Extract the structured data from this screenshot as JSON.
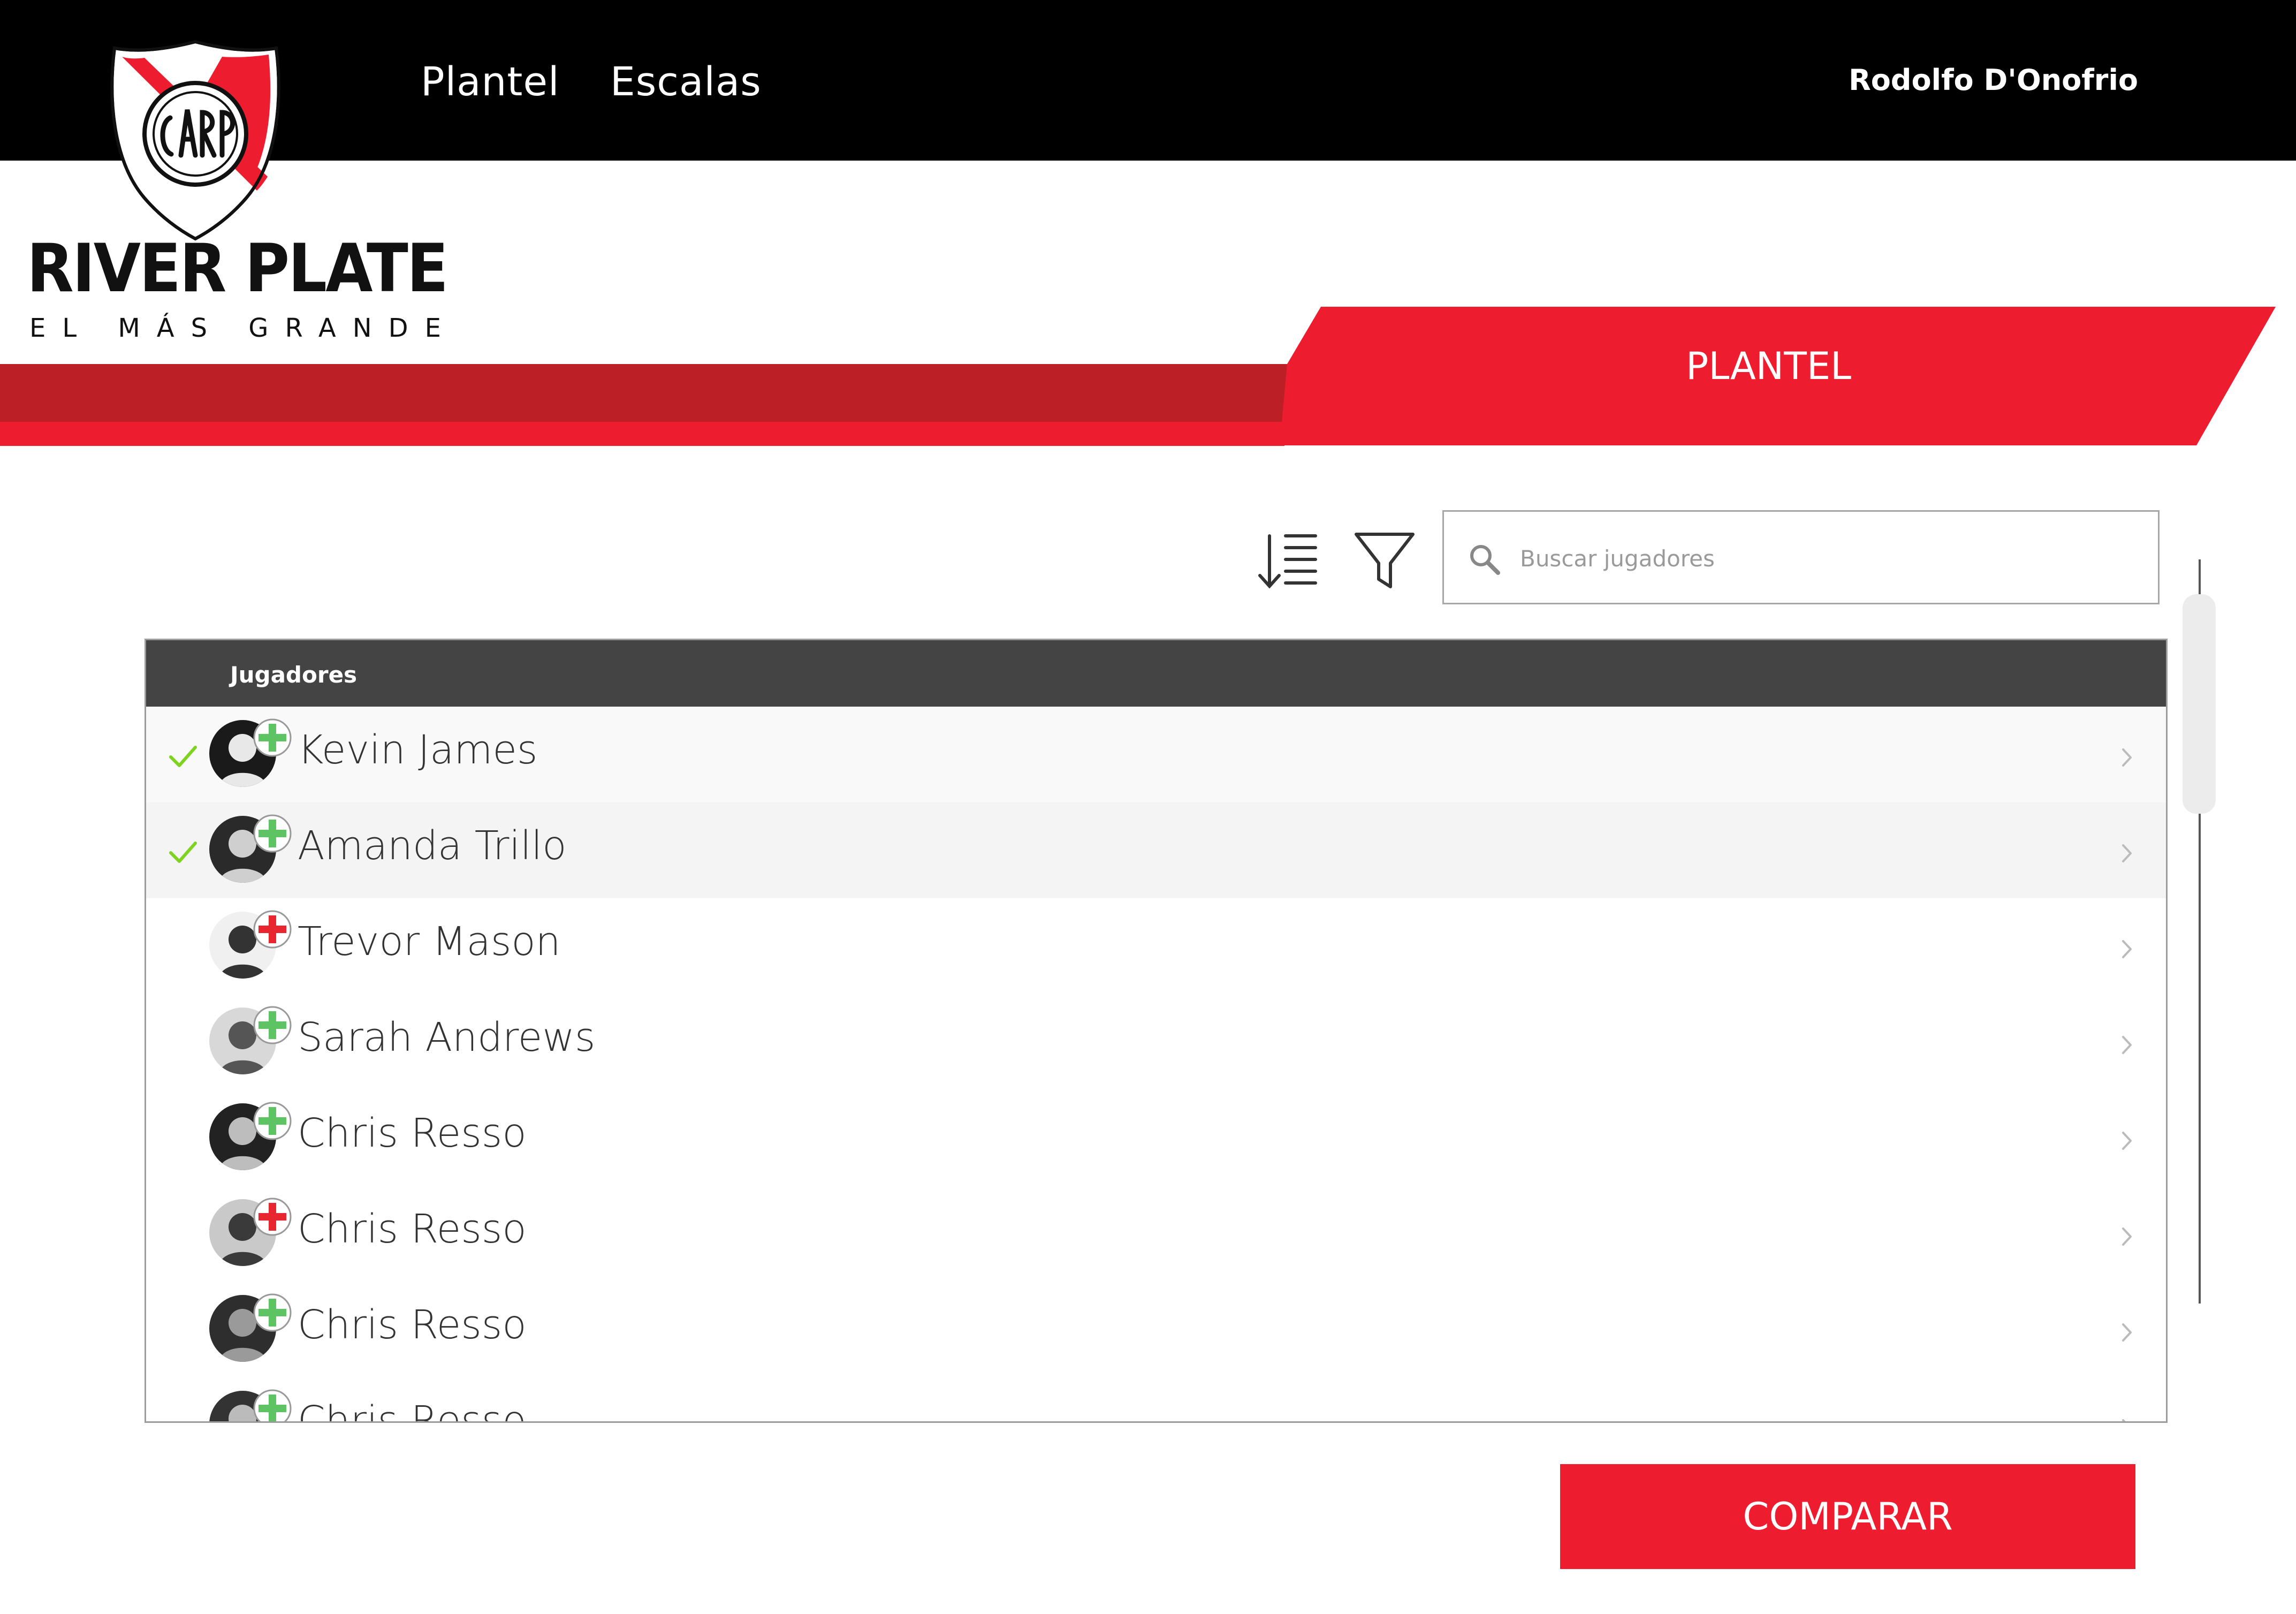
{
  "header": {
    "nav": [
      "Plantel",
      "Escalas"
    ],
    "user_name": "Rodolfo D'Onofrio"
  },
  "brand": {
    "name": "RIVER PLATE",
    "tagline": "EL MÁS GRANDE",
    "logo_text": "CARP"
  },
  "banner": {
    "title": "PLANTEL"
  },
  "search": {
    "placeholder": "Buscar jugadores"
  },
  "table": {
    "header": "Jugadores",
    "rows": [
      {
        "name": "Kevin James",
        "checked": true,
        "status": "green"
      },
      {
        "name": "Amanda Trillo",
        "checked": true,
        "status": "green"
      },
      {
        "name": "Trevor Mason",
        "checked": false,
        "status": "red"
      },
      {
        "name": "Sarah Andrews",
        "checked": false,
        "status": "green"
      },
      {
        "name": "Chris Resso",
        "checked": false,
        "status": "green"
      },
      {
        "name": "Chris Resso",
        "checked": false,
        "status": "red"
      },
      {
        "name": "Chris Resso",
        "checked": false,
        "status": "green"
      },
      {
        "name": "Chris Resso",
        "checked": false,
        "status": "green"
      }
    ]
  },
  "compare_button": "COMPARAR",
  "colors": {
    "brand_red": "#ed1c2e",
    "dark_red": "#bd1f27",
    "header_black": "#000000",
    "table_header": "#444444",
    "status_green": "#5ec463",
    "status_red": "#e8262f",
    "check_green": "#7ed321"
  }
}
